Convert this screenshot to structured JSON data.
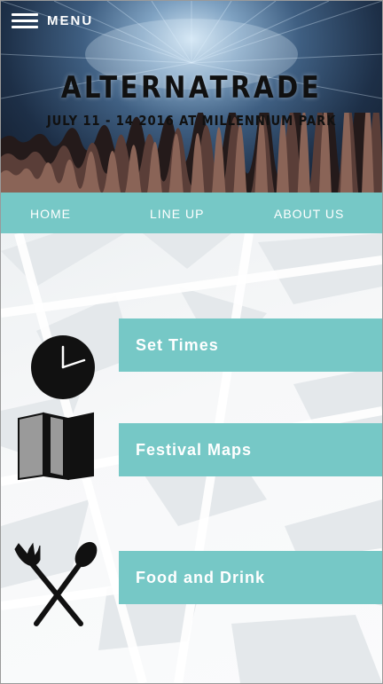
{
  "header": {
    "menu_label": "MENU",
    "title": "ALTERNATRADE",
    "subtitle": "JULY 11 - 14 2016 AT MILLENNIUM PARK"
  },
  "nav": {
    "items": [
      {
        "label": "HOME"
      },
      {
        "label": "LINE UP"
      },
      {
        "label": "ABOUT US"
      }
    ]
  },
  "main": {
    "items": [
      {
        "label": "Set Times",
        "icon": "clock-icon"
      },
      {
        "label": "Festival Maps",
        "icon": "map-icon"
      },
      {
        "label": "Food and Drink",
        "icon": "fork-spoon-icon"
      }
    ]
  },
  "colors": {
    "accent": "#76c8c6",
    "text_light": "#ffffff",
    "icon_dark": "#111111"
  }
}
